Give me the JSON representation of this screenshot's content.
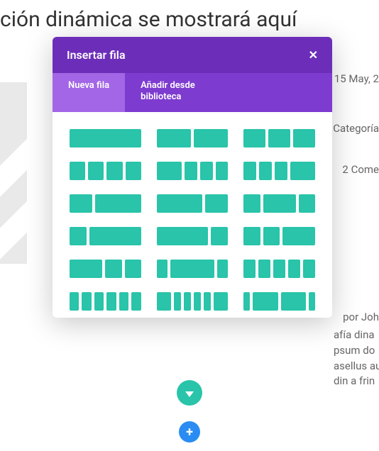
{
  "bg": {
    "title": "ción dinámica se mostrará aquí",
    "date": "15 May, 2",
    "category": "Categoría",
    "comments": "2 Come",
    "author": "por Joh",
    "body_l1": "afía dina",
    "body_l2": "psum do",
    "body_l3": "asellus au",
    "body_l4": "din a frin"
  },
  "modal": {
    "title": "Insertar fila",
    "tab_new": "Nueva fila",
    "tab_lib": "Añadir desde biblioteca"
  },
  "fab": {
    "add": "+"
  },
  "layouts": [
    [
      1
    ],
    [
      1,
      1
    ],
    [
      1,
      1,
      1
    ],
    [
      1,
      1,
      1,
      1
    ],
    [
      2,
      1,
      1,
      1
    ],
    [
      1,
      1,
      1,
      2
    ],
    [
      1,
      2
    ],
    [
      2,
      1
    ],
    [
      1,
      2,
      1
    ],
    [
      1,
      3
    ],
    [
      3,
      1
    ],
    [
      1,
      1,
      2
    ],
    [
      2,
      1,
      1
    ],
    [
      1,
      4,
      1
    ],
    [
      1,
      1,
      1,
      1,
      1
    ],
    [
      1,
      1,
      1,
      1,
      1,
      1
    ],
    [
      2,
      1,
      1,
      1,
      1,
      2
    ],
    [
      1,
      4,
      4,
      1
    ]
  ]
}
